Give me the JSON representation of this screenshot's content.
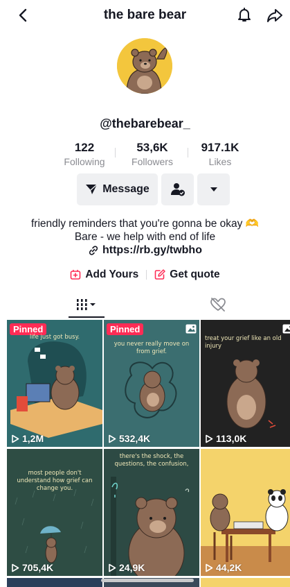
{
  "header": {
    "title": "the bare bear"
  },
  "profile": {
    "username": "@thebarebear_",
    "stats": [
      {
        "value": "122",
        "label": "Following"
      },
      {
        "value": "53,6K",
        "label": "Followers"
      },
      {
        "value": "917.1K",
        "label": "Likes"
      }
    ],
    "message_label": "Message",
    "bio_line1": "friendly reminders that you're gonna be okay 🫶",
    "bio_line2": "Bare - we help with end of life",
    "link": "https://rb.gy/twbho",
    "add_yours_label": "Add Yours",
    "get_quote_label": "Get quote"
  },
  "videos": [
    {
      "views": "1,2M",
      "pinned_label": "Pinned",
      "caption": "life just got busy.",
      "bg": "#2f6b6e"
    },
    {
      "views": "532,4K",
      "pinned_label": "Pinned",
      "caption": "you never really move on from grief.",
      "bg": "#3b6e70"
    },
    {
      "views": "113,0K",
      "caption": "treat your grief like an old injury",
      "bg": "#222222"
    },
    {
      "views": "705,4K",
      "caption": "most people don't understand how grief can change you.",
      "bg": "#2e4d44"
    },
    {
      "views": "24,9K",
      "caption": "there's the shock, the questions, the confusion,",
      "bg": "#2d4a44"
    },
    {
      "views": "44,2K",
      "caption": "",
      "bg": "#f4d36b"
    }
  ],
  "colors": {
    "accent": "#fe2c55",
    "text": "#161823",
    "muted": "#8a8b91",
    "button_bg": "#eff0f2"
  }
}
